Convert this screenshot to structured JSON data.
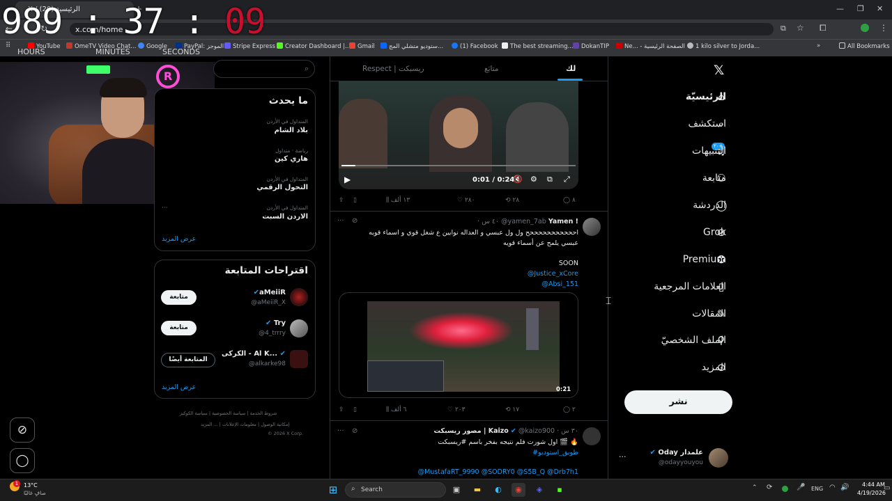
{
  "browser": {
    "tab_title": "X / الرئيسية (20)",
    "url": "x.com/home",
    "bookmarks": [
      "YouTube",
      "OmeTV Video Chat...",
      "Google",
      "PayPal: الموجز",
      "Stripe Express",
      "Creator Dashboard |...",
      "Gmail",
      "ستوديو متشلي المج...",
      "(1) Facebook",
      "The best streaming...",
      "DokanTIP",
      "Ne... - الصفحة الرئيسية",
      "1 kilo silver to Jorda..."
    ],
    "all_bookmarks": "All Bookmarks"
  },
  "overlay": {
    "timer_main": "989 : 37 : ",
    "timer_red": "09",
    "hours": "HOURS",
    "minutes": "MINUTES",
    "seconds": "SECONDS"
  },
  "nav": {
    "home": "الرئيسيّة",
    "explore": "استكشف",
    "notifications": "التنبيهات",
    "notif_badge": "٢٠+",
    "follow": "متابعة",
    "chat": "الدردشة",
    "grok": "Grok",
    "premium": "Premium",
    "bookmarks": "العلامات المرجعية",
    "articles": "المقالات",
    "profile": "الملف الشخصيّ",
    "more": "المزيد",
    "post": "نشر"
  },
  "account": {
    "name": "Oday علمدار",
    "handle": "@odayyouyou"
  },
  "feed_tabs": {
    "for_you": "لك",
    "following": "متابَع",
    "respect": "Respect | ريسبكت"
  },
  "video1": {
    "time": "0:01 / 0:24"
  },
  "tweet1_actions": {
    "replies": "٨",
    "retweets": "٢٨",
    "likes": "٢٨٠",
    "views": "١٣ ألف"
  },
  "tweet2": {
    "name": "Yamen !",
    "handle": "@yamen_7ab",
    "time": "· ٤٠ س",
    "line1": "احححححححححححح ول ول عبسي و العداله نوايين ع شغل قوي و اسماء قويه",
    "line2": "عبسي يلمح عن أسماء قويه",
    "soon": "SOON",
    "mention1": "@Justice_xCore",
    "mention2": "@Absi_151",
    "video_time": "0:21",
    "replies": "٢",
    "retweets": "١٧",
    "likes": "٢٠٣",
    "views": "٦ ألف"
  },
  "tweet3": {
    "name": "مصور ريسبكت | Kaizo",
    "handle": "@kaizo900",
    "time": "· ٣٠ س",
    "line1": "اول شورت فلم نتيجه بفخر باسم #ريسبكت 🎬 🔥",
    "hashtag": "#طويق_استوديو",
    "mentions": "@MustafaRT_9990 @SODRY0 @S5B_Q @Drb7h1"
  },
  "trends": {
    "title": "ما يحدث",
    "items": [
      {
        "meta": "المتداول في الأردن",
        "name": "بلاد الشام"
      },
      {
        "meta": "رياضة · متداول",
        "name": "هاري كين"
      },
      {
        "meta": "المتداول في الأردن",
        "name": "التحول الرقمي"
      },
      {
        "meta": "المتداول في الأردن",
        "name": "الاردن السبت"
      }
    ],
    "show_more": "عرض المزيد"
  },
  "suggestions": {
    "title": "اقتراحات المتابعة",
    "items": [
      {
        "name": "aMeiiR",
        "handle": "@aMeiiR_X",
        "button": "متابعة"
      },
      {
        "name": "Try",
        "handle": "@4_trrry",
        "button": "متابعة"
      },
      {
        "name": "الكركى - Al K...",
        "handle": "@alkarke98",
        "button": "المتابعة أيضًا"
      }
    ],
    "show_more": "عرض المزيد"
  },
  "footer": {
    "l1": "شروط الخدمة | سياسة الخصوصية | سياسة الكوكيز",
    "l2": "إمكانية الوصول | معلومات الإعلانات | ... المزيد",
    "copy": "© 2026 X Corp."
  },
  "taskbar": {
    "weather_temp": "13°C",
    "weather_desc": "صافٍ غالبًا",
    "search": "Search",
    "lang": "ENG",
    "time": "4:44 AM",
    "date": "4/19/2026"
  },
  "colors": {
    "accent": "#1d9bf0",
    "bg": "#000000",
    "text": "#e7e9ea",
    "muted": "#71767b"
  }
}
